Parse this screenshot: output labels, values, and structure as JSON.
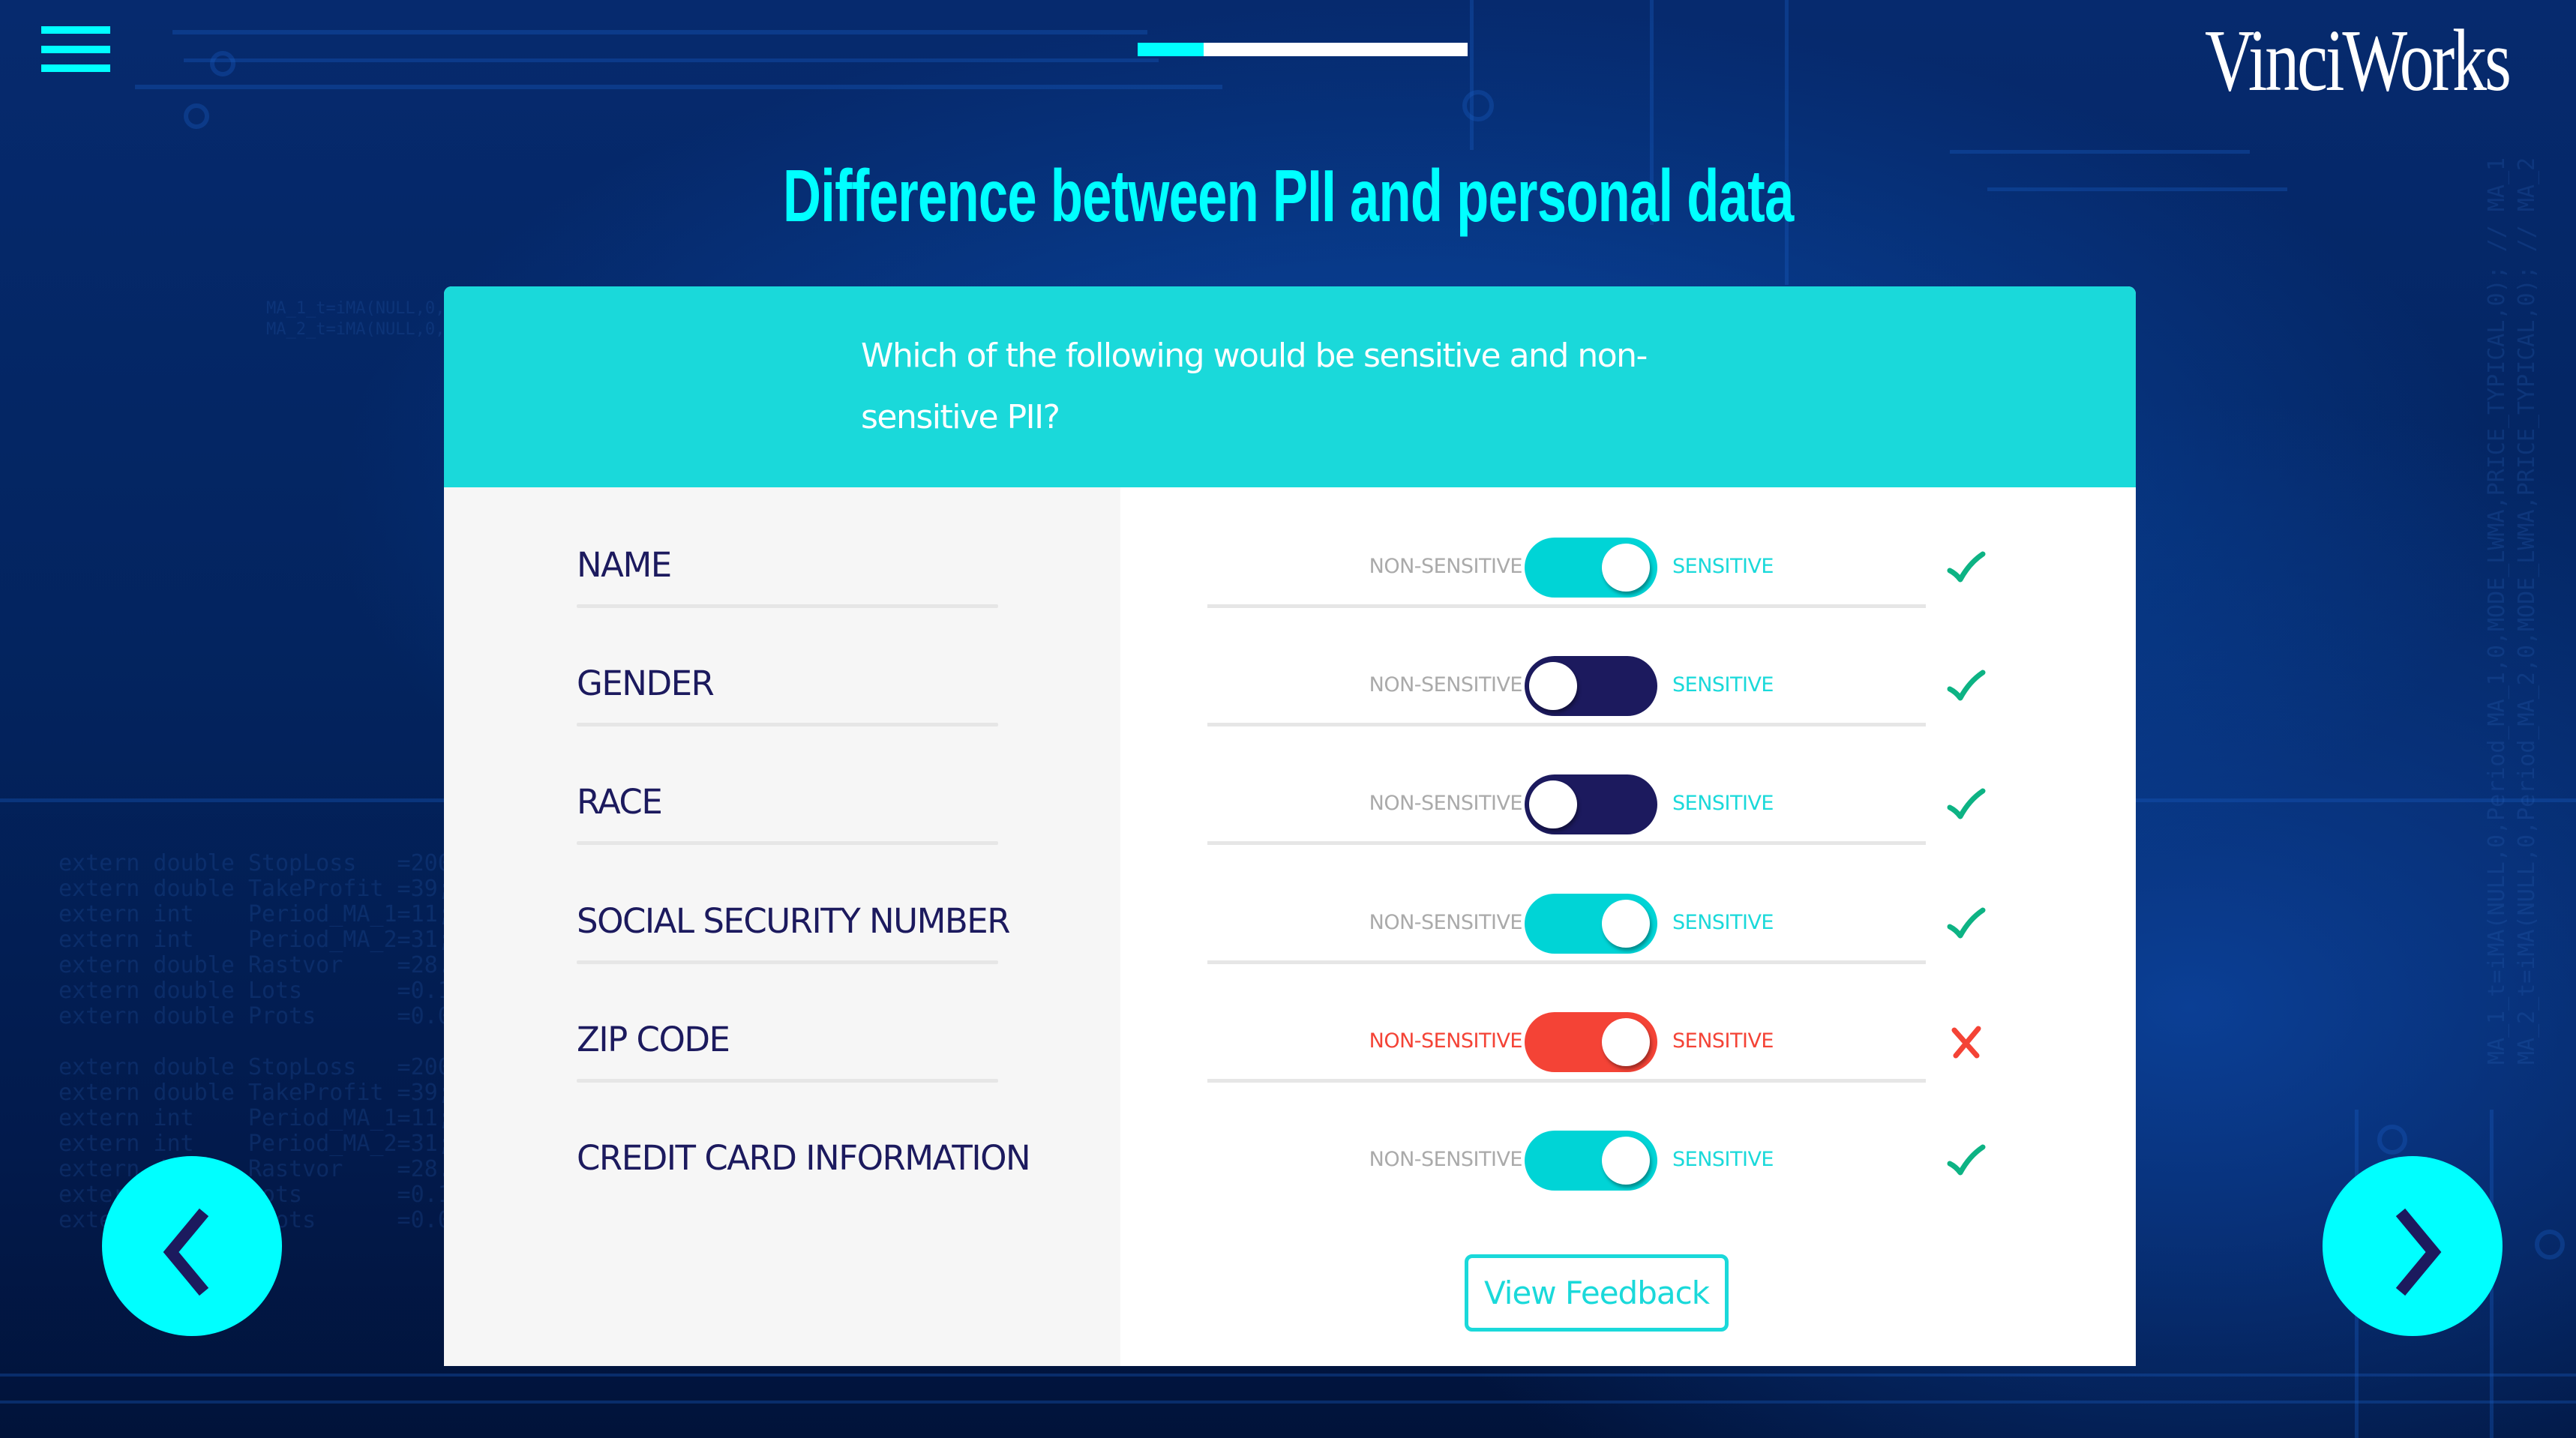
{
  "header": {
    "menu_icon": "hamburger-menu-icon",
    "progress_fraction": 0.2,
    "logo_text": "VinciWorks"
  },
  "page": {
    "title": "Difference between PII and personal data"
  },
  "question": {
    "text": "Which of the following would be sensitive and non-sensitive PII?"
  },
  "options": {
    "left_label": "NON-SENSITIVE",
    "right_label": "SENSITIVE"
  },
  "colors": {
    "accent": "#00ffff",
    "teal": "#1ad9da",
    "navy": "#1c1a5e",
    "correct": "#0db384",
    "incorrect": "#f44336",
    "label_gray": "#aaaaaa",
    "line_gray": "#e6e6e6"
  },
  "rows": [
    {
      "label": "NAME",
      "toggle": "sensitive",
      "toggle_state": "on",
      "result": "correct"
    },
    {
      "label": "GENDER",
      "toggle": "non-sensitive",
      "toggle_state": "off",
      "result": "correct"
    },
    {
      "label": "RACE",
      "toggle": "non-sensitive",
      "toggle_state": "off",
      "result": "correct"
    },
    {
      "label": "SOCIAL SECURITY NUMBER",
      "toggle": "sensitive",
      "toggle_state": "on",
      "result": "correct"
    },
    {
      "label": "ZIP CODE",
      "toggle": "sensitive",
      "toggle_state": "on",
      "result": "incorrect"
    },
    {
      "label": "CREDIT CARD INFORMATION",
      "toggle": "sensitive",
      "toggle_state": "on",
      "result": "correct"
    }
  ],
  "buttons": {
    "view_feedback": "View Feedback",
    "prev_icon": "chevron-left-icon",
    "next_icon": "chevron-right-icon"
  }
}
